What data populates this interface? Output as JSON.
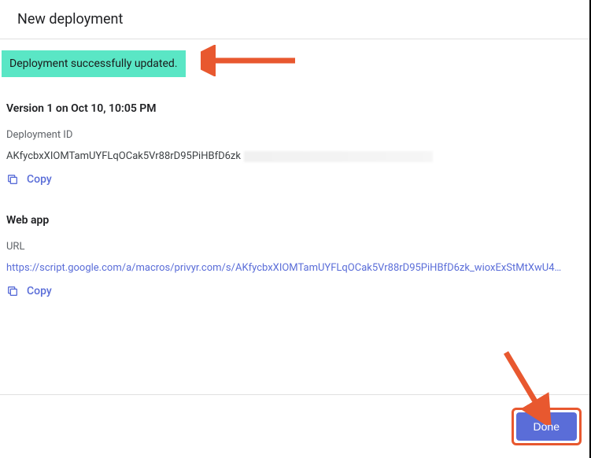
{
  "header": {
    "title": "New deployment"
  },
  "banner": {
    "text": "Deployment successfully updated."
  },
  "version": {
    "line": "Version 1 on Oct 10, 10:05 PM"
  },
  "deployment": {
    "label": "Deployment ID",
    "id": "AKfycbxXIOMTamUYFLqOCak5Vr88rD95PiHBfD6zk",
    "copy_label": "Copy"
  },
  "webapp": {
    "title": "Web app",
    "url_label": "URL",
    "url": "https://script.google.com/a/macros/privyr.com/s/AKfycbxXIOMTamUYFLqOCak5Vr88rD95PiHBfD6zk_wioxExStMtXwU4…",
    "copy_label": "Copy"
  },
  "footer": {
    "done_label": "Done"
  }
}
